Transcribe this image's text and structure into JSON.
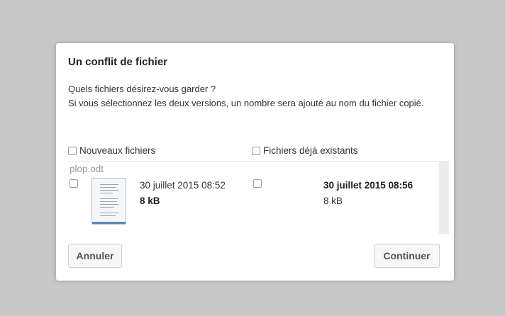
{
  "dialog": {
    "title": "Un conflit de fichier",
    "message_line1": "Quels fichiers désirez-vous garder ?",
    "message_line2": "Si vous sélectionnez les deux versions, un nombre sera ajouté au nom du fichier copié.",
    "columns": {
      "new_label": "Nouveaux fichiers",
      "existing_label": "Fichiers déjà existants"
    },
    "conflict": {
      "filename": "plop.odt",
      "new": {
        "date": "30 juillet 2015 08:52",
        "size": "8 kB",
        "checked": false
      },
      "existing": {
        "date": "30 juillet 2015 08:56",
        "size": "8 kB",
        "checked": false
      }
    },
    "buttons": {
      "cancel": "Annuler",
      "continue": "Continuer"
    }
  },
  "icons": {
    "thumbnail": "document-thumbnail-icon"
  }
}
